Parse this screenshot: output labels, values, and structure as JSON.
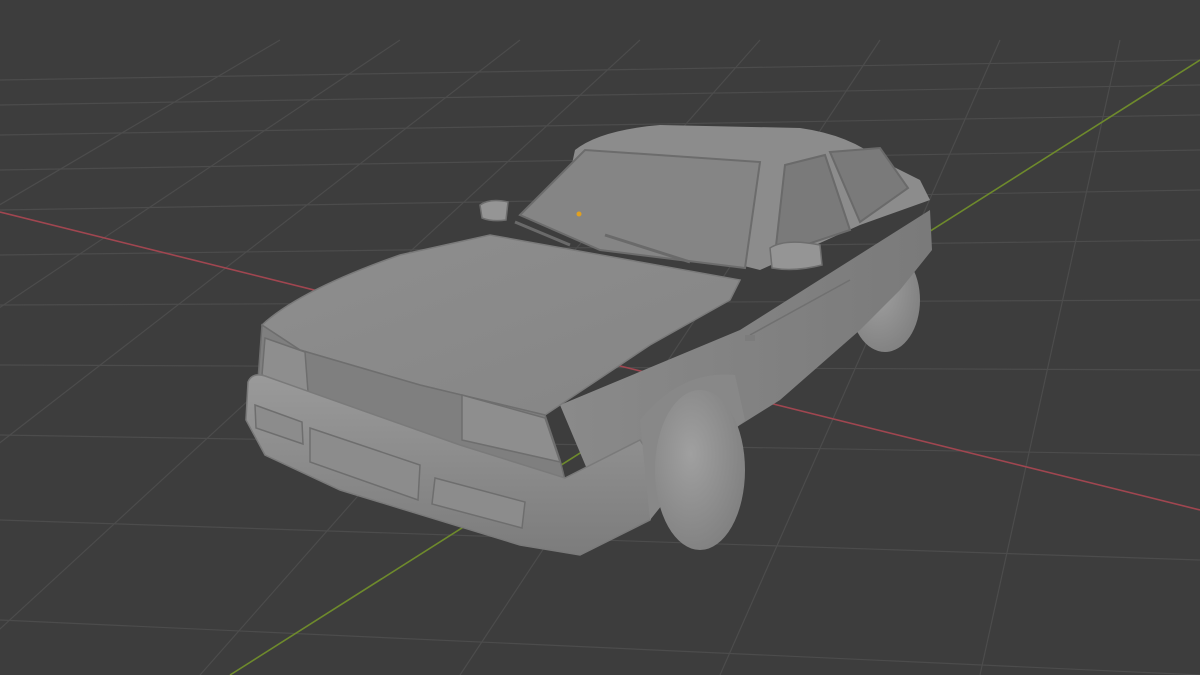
{
  "viewport": {
    "mode": "solid-shading",
    "background_color": "#3d3d3d",
    "grid_color": "#4c4c4c",
    "x_axis_color": "#a04650",
    "y_axis_color": "#6e8a2c"
  },
  "model": {
    "body_color": "#8a8a8a",
    "light_color": "#9c9c9c",
    "shadow_color": "#6c6c6c",
    "origin_color": "#e0a020"
  }
}
